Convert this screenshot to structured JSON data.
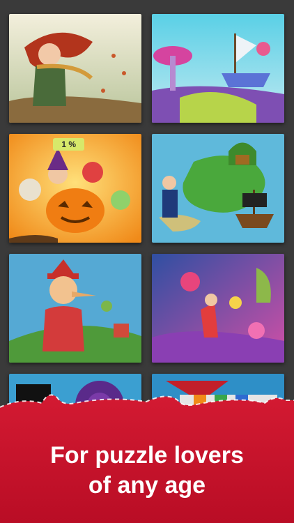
{
  "puzzles": [
    {
      "name": "girl-autumn"
    },
    {
      "name": "fantasy-ship"
    },
    {
      "name": "halloween-kids",
      "progress_label": "1 %",
      "progress": 0.01
    },
    {
      "name": "pirate-island"
    },
    {
      "name": "pinocchio"
    },
    {
      "name": "candy-world"
    },
    {
      "name": "partial-tile-left"
    },
    {
      "name": "partial-tile-right"
    }
  ],
  "banner": {
    "line1": "For puzzle lovers",
    "line2": "of any age",
    "color": "#c8102e"
  }
}
